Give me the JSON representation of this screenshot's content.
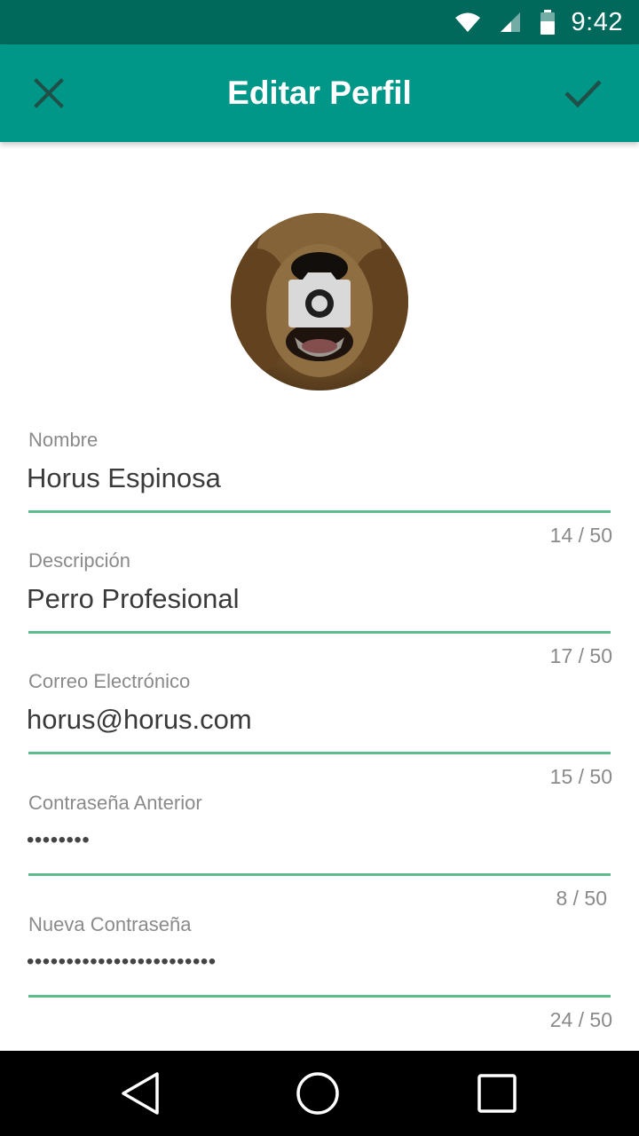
{
  "status_bar": {
    "time": "9:42",
    "icons": [
      "wifi-icon",
      "cell-signal-icon",
      "battery-icon"
    ]
  },
  "app_bar": {
    "title": "Editar Perfil",
    "left_icon": "close-icon",
    "right_icon": "check-icon",
    "color": "#009688",
    "status_color": "#00695c"
  },
  "avatar": {
    "icon": "camera-icon"
  },
  "form": {
    "accent_color": "#5dbb8c",
    "fields": [
      {
        "label": "Nombre",
        "value": "Horus Espinosa",
        "counter": "14 / 50"
      },
      {
        "label": "Descripción",
        "value": "Perro Profesional",
        "counter": "17 / 50"
      },
      {
        "label": "Correo Electrónico",
        "value": "horus@horus.com",
        "counter": "15 / 50"
      },
      {
        "label": "Contraseña Anterior",
        "value": "••••••••",
        "counter": "8 / 50"
      },
      {
        "label": "Nueva Contraseña",
        "value": "••••••••••••••••••••••••",
        "counter": "24 / 50"
      }
    ]
  },
  "nav_bar": {
    "icons": [
      "back-icon",
      "home-icon",
      "recents-icon"
    ]
  }
}
